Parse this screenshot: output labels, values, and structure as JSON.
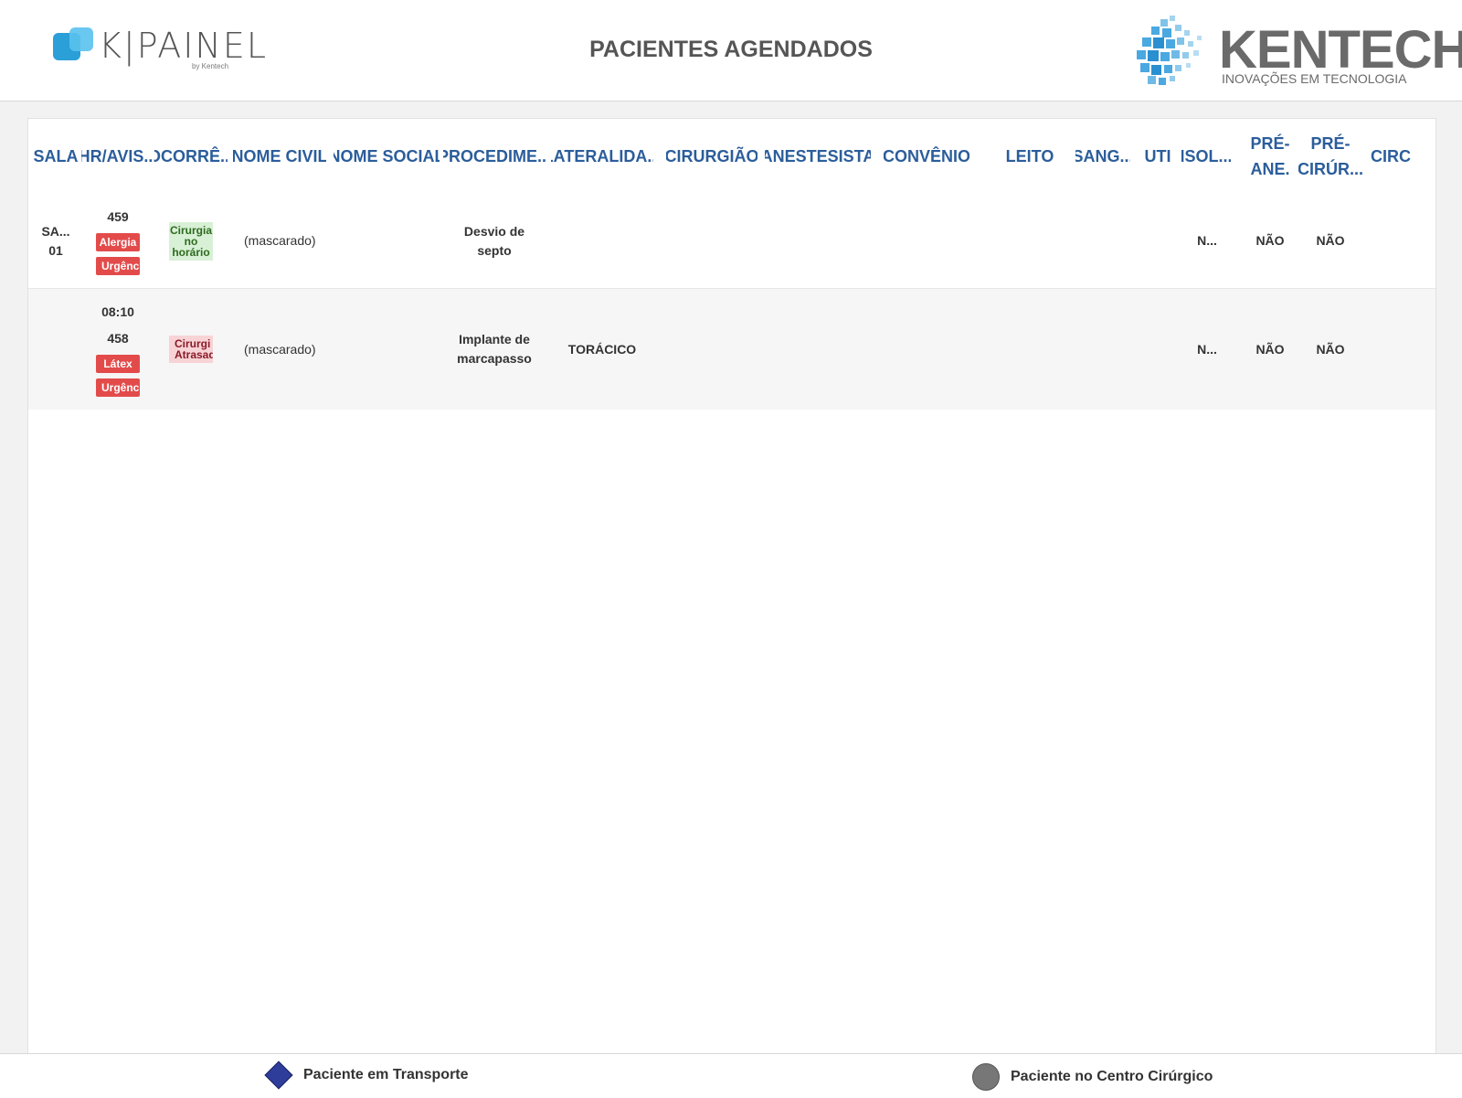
{
  "header": {
    "title": "PACIENTES AGENDADOS",
    "left_logo_text": "K|PAINEL",
    "left_logo_by": "by Kentech",
    "right_logo_name": "KENTECH",
    "right_logo_sub": "INOVAÇÕES EM TECNOLOGIA"
  },
  "columns": [
    {
      "key": "sala",
      "label": "SALA"
    },
    {
      "key": "hr_aviso",
      "label": "HR/AVIS..."
    },
    {
      "key": "ocorrencia",
      "label": "OCORRÊ..."
    },
    {
      "key": "nome_civil",
      "label": "NOME CIVIL"
    },
    {
      "key": "nome_social",
      "label": "NOME SOCIAL"
    },
    {
      "key": "procedimento",
      "label": "PROCEDIME..."
    },
    {
      "key": "lateralidade",
      "label": "LATERALIDA..."
    },
    {
      "key": "cirurgiao",
      "label": "CIRURGIÃO"
    },
    {
      "key": "anestesista",
      "label": "ANESTESISTA"
    },
    {
      "key": "convenio",
      "label": "CONVÊNIO"
    },
    {
      "key": "leito",
      "label": "LEITO"
    },
    {
      "key": "sangue",
      "label": "SANG..."
    },
    {
      "key": "uti",
      "label": "UTI"
    },
    {
      "key": "isolamento",
      "label": "ISOL..."
    },
    {
      "key": "pre_ane",
      "label_line1": "PRÉ-",
      "label_line2": "ANE."
    },
    {
      "key": "pre_cir",
      "label_line1": "PRÉ-",
      "label_line2": "CIRÚR..."
    },
    {
      "key": "circ",
      "label": "CIRC"
    }
  ],
  "rows": [
    {
      "sala": "SA...",
      "sala_num": "01",
      "hora": "",
      "aviso": "459",
      "badges": [
        "Alergia",
        "Urgênc"
      ],
      "ocorrencia": {
        "lines": [
          "Cirurgia",
          "no",
          "horário"
        ],
        "status": "on-time"
      },
      "nome_civil": "(mascarado)",
      "nome_social": "",
      "procedimento": "Desvio de septo",
      "lateralidade": "",
      "isolamento": "N...",
      "pre_ane": "NÃO",
      "pre_cir": "NÃO"
    },
    {
      "sala": "",
      "sala_num": "",
      "hora": "08:10",
      "aviso": "458",
      "badges": [
        "Látex",
        "Urgênc"
      ],
      "ocorrencia": {
        "lines": [
          "Cirurgi",
          "Atrasad"
        ],
        "status": "delayed"
      },
      "nome_civil": "(mascarado)",
      "nome_social": "",
      "procedimento": "Implante de marcapasso",
      "lateralidade": "TORÁCICO",
      "isolamento": "N...",
      "pre_ane": "NÃO",
      "pre_cir": "NÃO"
    }
  ],
  "legend": {
    "transport": "Paciente em Transporte",
    "center": "Paciente no Centro Cirúrgico"
  },
  "colors": {
    "header_text": "#2b5d9b",
    "badge_red": "#e34b4b",
    "occ_green_bg": "#d8f0d5",
    "occ_red_bg": "#f7d3d6",
    "transport_marker": "#2e3d9a",
    "center_marker": "#777777"
  },
  "icons": {
    "transport": "diamond-icon",
    "center": "circle-icon"
  }
}
